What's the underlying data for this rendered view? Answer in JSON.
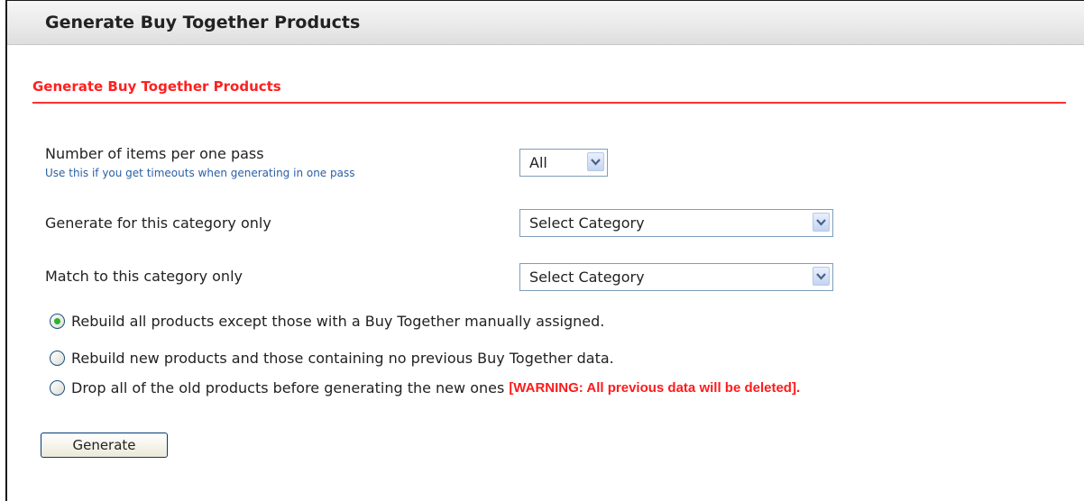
{
  "panel": {
    "title": "Generate Buy Together Products"
  },
  "section": {
    "title": "Generate Buy Together Products"
  },
  "form": {
    "items_per_pass": {
      "label": "Number of items per one pass",
      "hint": "Use this if you get timeouts when generating in one pass",
      "value": "All"
    },
    "generate_category": {
      "label": "Generate for this category only",
      "value": "Select Category"
    },
    "match_category": {
      "label": "Match to this category only",
      "value": "Select Category"
    },
    "options": [
      {
        "label": "Rebuild all products except those with a Buy Together manually assigned.",
        "checked": true
      },
      {
        "label": "Rebuild new products and those containing no previous Buy Together data.",
        "checked": false
      },
      {
        "label": "Drop all of the old products before generating the new ones",
        "warning": "[WARNING: All previous data will be deleted].",
        "checked": false
      }
    ],
    "generate_label": "Generate"
  },
  "colors": {
    "accent_red": "#ff2020",
    "hint_blue": "#2b5fa6",
    "radio_green": "#2bb32b"
  },
  "icons": {
    "dropdown": "chevron-down-icon"
  }
}
